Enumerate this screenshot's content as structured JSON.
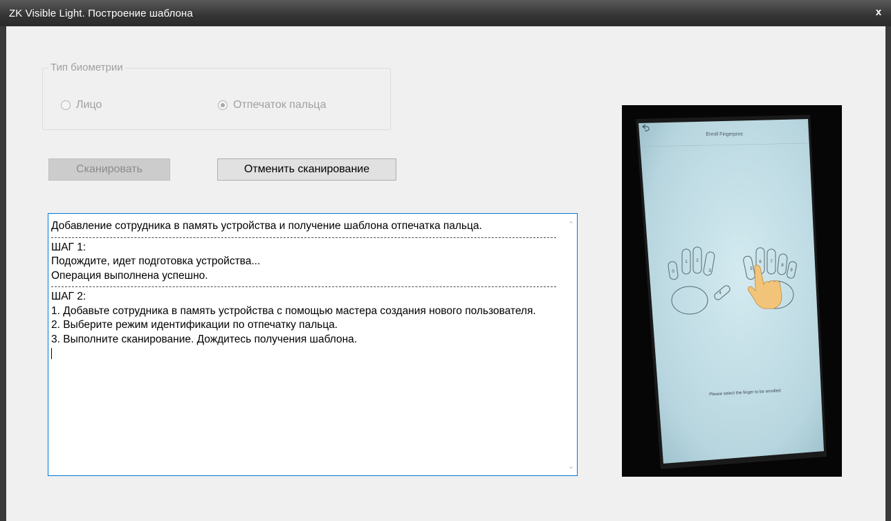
{
  "window": {
    "title": "ZK Visible Light. Построение шаблона",
    "close_label": "x"
  },
  "biometry": {
    "legend": "Тип биометрии",
    "options": [
      {
        "label": "Лицо",
        "selected": false
      },
      {
        "label": "Отпечаток пальца",
        "selected": true
      }
    ]
  },
  "buttons": {
    "scan_label": "Сканировать",
    "cancel_label": "Отменить сканирование"
  },
  "log": {
    "line1": "Добавление сотрудника в память устройства и получение шаблона отпечатка пальца.",
    "step1_title": "ШАГ 1:",
    "step1_line1": "Подождите, идет подготовка устройства...",
    "step1_line2": "Операция выполнена успешно.",
    "step2_title": "ШАГ 2:",
    "step2_line1": "1. Добавьте сотрудника в память устройства с помощью мастера создания нового пользователя.",
    "step2_line2": "2. Выберите режим идентификации по отпечатку пальца.",
    "step2_line3": "3. Выполните сканирование. Дождитесь получения шаблона."
  },
  "photo": {
    "header": "Enroll Fingerprint",
    "instruction": "Please select the finger to be enrolled",
    "left_fingers": [
      "0",
      "1",
      "2",
      "3",
      "4"
    ],
    "right_fingers": [
      "5",
      "6",
      "7",
      "8",
      "9"
    ],
    "colors": {
      "screen": "#bcdbe4",
      "hand_pointer": "#f2c47a"
    }
  }
}
